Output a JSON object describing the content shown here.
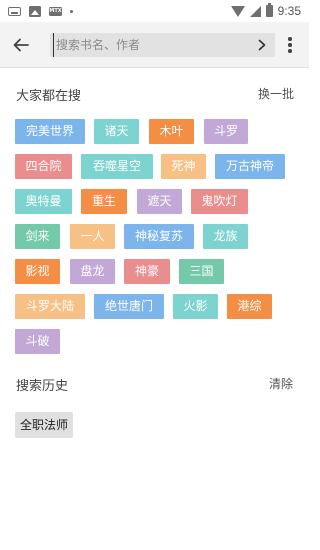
{
  "status_bar": {
    "time": "9:35",
    "left_icons": [
      "keyboard-icon",
      "image-icon",
      "mtx-icon",
      "dot-icon"
    ],
    "right_icons": [
      "wifi-icon",
      "signal-icon",
      "battery-icon"
    ],
    "mtx_label": "MTX"
  },
  "top_bar": {
    "search_placeholder": "搜索书名、作者",
    "search_value": ""
  },
  "hot": {
    "title": "大家都在搜",
    "refresh_label": "换一批",
    "tags": [
      {
        "label": "完美世界",
        "color": "#7cb5ec"
      },
      {
        "label": "诸天",
        "color": "#7dd3cf"
      },
      {
        "label": "木叶",
        "color": "#f58e45"
      },
      {
        "label": "斗罗",
        "color": "#c2a8d6"
      },
      {
        "label": "四合院",
        "color": "#ea8d8d"
      },
      {
        "label": "吞噬星空",
        "color": "#7dd3cf"
      },
      {
        "label": "死神",
        "color": "#f7c186"
      },
      {
        "label": "万古神帝",
        "color": "#7cb5ec"
      },
      {
        "label": "奥特曼",
        "color": "#7dd3cf"
      },
      {
        "label": "重生",
        "color": "#f58e45"
      },
      {
        "label": "遮天",
        "color": "#c2a8d6"
      },
      {
        "label": "鬼吹灯",
        "color": "#ea8d8d"
      },
      {
        "label": "剑来",
        "color": "#74c9a8"
      },
      {
        "label": "一人",
        "color": "#f7c186"
      },
      {
        "label": "神秘复苏",
        "color": "#7cb5ec"
      },
      {
        "label": "龙族",
        "color": "#7dd3cf"
      },
      {
        "label": "影视",
        "color": "#f58e45"
      },
      {
        "label": "盘龙",
        "color": "#c2a8d6"
      },
      {
        "label": "神豪",
        "color": "#ea8d8d"
      },
      {
        "label": "三国",
        "color": "#74c9a8"
      },
      {
        "label": "斗罗大陆",
        "color": "#f7c186"
      },
      {
        "label": "绝世唐门",
        "color": "#7cb5ec"
      },
      {
        "label": "火影",
        "color": "#7dd3cf"
      },
      {
        "label": "港综",
        "color": "#f58e45"
      },
      {
        "label": "斗破",
        "color": "#c2a8d6"
      }
    ]
  },
  "history": {
    "title": "搜索历史",
    "clear_label": "清除",
    "items": [
      "全职法师"
    ]
  }
}
